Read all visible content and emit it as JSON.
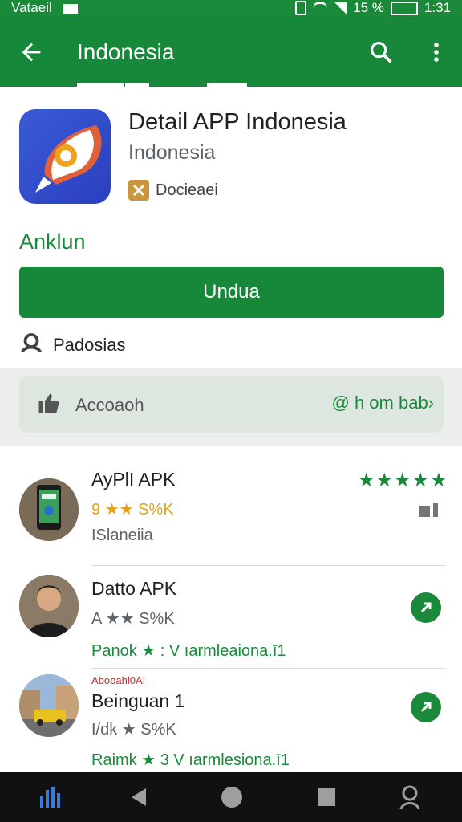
{
  "status_bar": {
    "carrier": "Vataeil",
    "battery": "15 %",
    "time": "1:31"
  },
  "app_bar": {
    "title": "Indonesia"
  },
  "app": {
    "name": "Detail APP Indonesia",
    "developer": "Indonesia",
    "category": "Docieaei",
    "section_label": "Anklun",
    "install_label": "Undua",
    "permissions_label": "Padosias"
  },
  "rating_card": {
    "left_label": "Accoaoh",
    "right_label": "@ h om bab›"
  },
  "related": [
    {
      "title": "AyPlI APK",
      "meta": "9 ★★ S%K",
      "sub": "ISlaneiia",
      "rating": "★★★★★"
    },
    {
      "title": "Datto APK",
      "meta": "A ★★ S%K",
      "sub": "Panok ★ : V ıarmleaiona.ī1"
    },
    {
      "title_pre": "Abobahl0AI",
      "title": "Beinguan 1",
      "meta": "I/dk ★ S%K",
      "sub": "Raimk ★ 3 V ıarmlesiona.ī1"
    }
  ],
  "colors": {
    "brand_green": "#17883a",
    "star_gold": "#e2a31b"
  },
  "icons": [
    "back-arrow-icon",
    "search-icon",
    "more-vert-icon",
    "thumbs-up-icon",
    "person-settings-icon",
    "chevron-icon"
  ]
}
